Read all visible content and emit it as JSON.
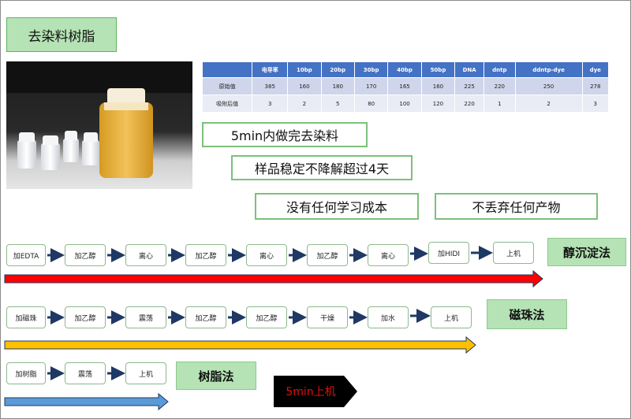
{
  "title": "去染料树脂",
  "table": {
    "headers": [
      "",
      "电导率",
      "10bp",
      "20bp",
      "30bp",
      "40bp",
      "50bp",
      "DNA",
      "dntp",
      "ddntp-dye",
      "dye"
    ],
    "rows": [
      [
        "原始值",
        "385",
        "160",
        "180",
        "170",
        "165",
        "160",
        "225",
        "220",
        "250",
        "278"
      ],
      [
        "吸附后值",
        "3",
        "2",
        "5",
        "80",
        "100",
        "120",
        "220",
        "1",
        "2",
        "3"
      ]
    ]
  },
  "notes": {
    "n1": "5min内做完去染料",
    "n2": "样品稳定不降解超过4天",
    "n3": "没有任何学习成本",
    "n4": "不丢弃任何产物"
  },
  "workflow1": {
    "steps": [
      "加EDTA",
      "加乙醇",
      "离心",
      "加乙醇",
      "离心",
      "加乙醇",
      "离心",
      "加HIDI",
      "上机"
    ],
    "method": "醇沉淀法",
    "arrow_color": "#ff0000"
  },
  "workflow2": {
    "steps": [
      "加磁珠",
      "加乙醇",
      "震荡",
      "加乙醇",
      "加乙醇",
      "干燥",
      "加水",
      "上机"
    ],
    "method": "磁珠法",
    "arrow_color": "#ffc000"
  },
  "workflow3": {
    "steps": [
      "加树脂",
      "震荡",
      "上机"
    ],
    "method": "树脂法",
    "arrow_color": "#5b9bd5"
  },
  "banner": "5min上机",
  "colors": {
    "method_fill": "#b5e3b5",
    "step_border": "#8fb88f",
    "connector": "#1f3864",
    "table_header": "#4472c4"
  }
}
